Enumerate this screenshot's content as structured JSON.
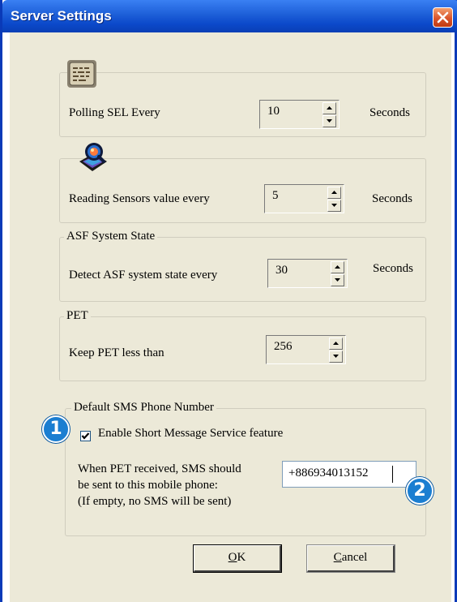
{
  "window": {
    "title": "Server Settings"
  },
  "polling": {
    "label": "Polling SEL Every",
    "value": "10",
    "unit": "Seconds"
  },
  "sensors": {
    "label": "Reading Sensors value every",
    "value": "5",
    "unit": "Seconds"
  },
  "asf": {
    "legend": "ASF System State",
    "label": "Detect ASF system state every",
    "value": "30",
    "unit": "Seconds"
  },
  "pet": {
    "legend": "PET",
    "label": "Keep PET less than",
    "value": "256"
  },
  "sms": {
    "legend": "Default SMS Phone Number",
    "checkbox_label": "Enable Short Message Service feature",
    "checked": true,
    "desc_line1": "When PET received, SMS should",
    "desc_line2": "be sent to this mobile phone:",
    "desc_line3": "(If empty, no SMS will be sent)",
    "phone": "+886934013152"
  },
  "buttons": {
    "ok_rest": "K",
    "ok_underline": "O",
    "cancel_underline": "C",
    "cancel_rest": "ancel"
  },
  "callouts": {
    "one": "1",
    "two": "2"
  },
  "colors": {
    "title_bar": "#0b48c9",
    "dialog_bg": "#ece9d8",
    "callout": "#1b7ed1",
    "close": "#d9542c"
  },
  "icons": {
    "polling": "event-log-icon",
    "sensors": "sensor-reading-icon"
  }
}
